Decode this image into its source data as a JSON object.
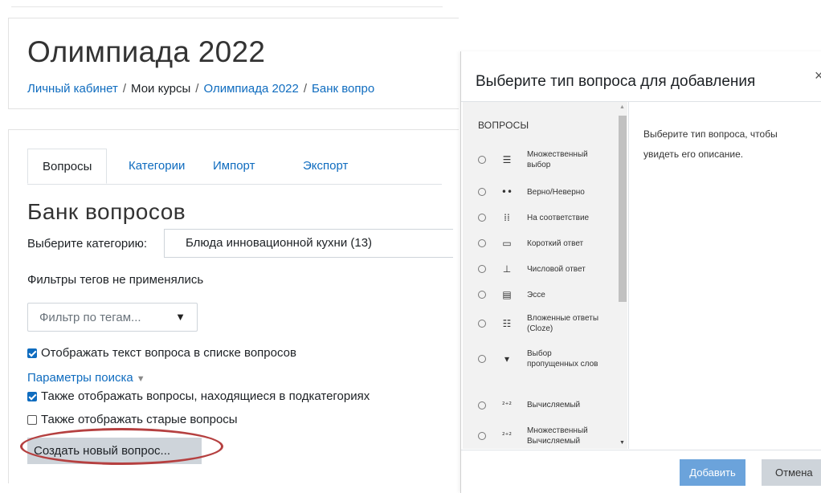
{
  "course": {
    "title": "Олимпиада 2022",
    "breadcrumb": [
      "Личный кабинет",
      "Мои курсы",
      "Олимпиада 2022",
      "Банк вопро"
    ]
  },
  "tabs": [
    "Вопросы",
    "Категории",
    "Импорт",
    "Экспорт"
  ],
  "bank": {
    "title": "Банк вопросов",
    "category_label": "Выберите категорию:",
    "category_value": "Блюда инновационной кухни (13)",
    "tag_info": "Фильтры тегов не применялись",
    "tag_filter_placeholder": "Фильтр по тегам...",
    "show_text_label": "Отображать текст вопроса в списке вопросов",
    "show_text_checked": true,
    "search_params": "Параметры поиска",
    "subcat_label": "Также отображать вопросы, находящиеся в подкатегориях",
    "subcat_checked": true,
    "old_label": "Также отображать старые вопросы",
    "old_checked": false,
    "create_button": "Создать новый вопрос..."
  },
  "modal": {
    "title": "Выберите тип вопроса для добавления",
    "close": "×",
    "section": "ВОПРОСЫ",
    "options": [
      {
        "label": "Множественный выбор",
        "icon": "list-icon",
        "glyph": "☰"
      },
      {
        "label": "Верно/Неверно",
        "icon": "dots-icon",
        "glyph": "••"
      },
      {
        "label": "На соответствие",
        "icon": "matching-icon",
        "glyph": "⁞⁞"
      },
      {
        "label": "Короткий ответ",
        "icon": "textbox-icon",
        "glyph": "▭"
      },
      {
        "label": "Числовой ответ",
        "icon": "numeric-icon",
        "glyph": "⊥"
      },
      {
        "label": "Эссе",
        "icon": "document-icon",
        "glyph": "▤"
      },
      {
        "label": "Вложенные ответы (Cloze)",
        "icon": "cloze-icon",
        "glyph": "☷"
      },
      {
        "label": "Выбор пропущенных слов",
        "icon": "dropdown-icon",
        "glyph": "▾"
      },
      {
        "label": "Вычисляемый",
        "icon": "calculated-icon",
        "glyph": "²⁺²"
      },
      {
        "label": "Множественный Вычисляемый",
        "icon": "calculated-multi-icon",
        "glyph": "²⁺²"
      }
    ],
    "description": "Выберите тип вопроса, чтобы увидеть его описание.",
    "add_button": "Добавить",
    "cancel_button": "Отмена"
  },
  "colors": {
    "link": "#0f6cbf",
    "primary_disabled": "#6ba3db",
    "highlight_ellipse": "#b54040"
  }
}
